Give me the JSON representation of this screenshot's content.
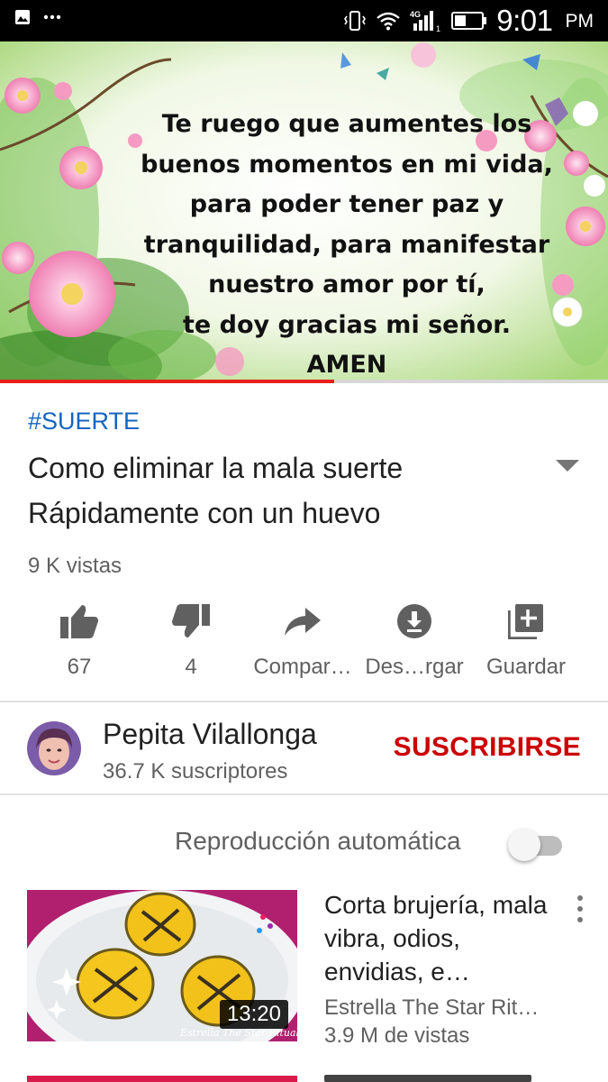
{
  "status_bar": {
    "time": "9:01",
    "ampm": "PM",
    "icons": [
      "image-notification-icon",
      "more-notifications-icon",
      "vibrate-icon",
      "wifi-icon",
      "signal-4g-icon",
      "battery-icon"
    ],
    "network_label": "4G",
    "sim_label": "1"
  },
  "video": {
    "verse_lines": [
      "Te ruego que aumentes los",
      "buenos momentos en mi vida,",
      "para poder tener paz y",
      "tranquilidad, para manifestar",
      "nuestro amor por tí,",
      "te doy gracias mi señor.",
      "AMEN"
    ],
    "progress_fraction": 0.55
  },
  "meta": {
    "hashtag": "#SUERTE",
    "title": "Como eliminar la mala suerte Rápidamente con un huevo",
    "views": "9 K vistas"
  },
  "actions": [
    {
      "icon": "thumbs-up-icon",
      "label": "67"
    },
    {
      "icon": "thumbs-down-icon",
      "label": "4"
    },
    {
      "icon": "share-icon",
      "label": "Compar…"
    },
    {
      "icon": "download-icon",
      "label": "Des…rgar"
    },
    {
      "icon": "add-to-playlist-icon",
      "label": "Guardar"
    }
  ],
  "channel": {
    "name": "Pepita Vilallonga",
    "subscribers": "36.7 K suscriptores",
    "subscribe_label": "SUSCRIBIRSE"
  },
  "autoplay": {
    "label": "Reproducción automática",
    "enabled": false
  },
  "up_next": [
    {
      "title": "Corta brujería, mala vibra, odios, envidias, e…",
      "channel": "Estrella The Star Rit…",
      "views": "3.9 M de vistas",
      "duration": "13:20",
      "watermark": "Estrella The Star Rituales"
    }
  ],
  "colors": {
    "accent_red": "#cc0000",
    "progress_red": "#e62117",
    "hashtag_blue": "#1565c0",
    "secondary_text": "#606060"
  }
}
